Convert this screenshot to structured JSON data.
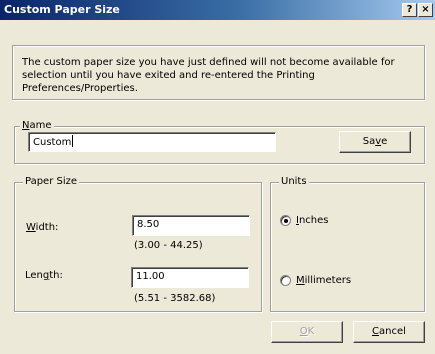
{
  "window": {
    "title": "Custom Paper Size",
    "help_button": "?",
    "close_button": "×"
  },
  "message": "The custom paper size you have just defined will not become available for selection until you have exited and re-entered the Printing Preferences/Properties.",
  "name_group": {
    "legend_prefix": "",
    "legend_accel": "N",
    "legend_rest": "ame",
    "value": "Custom",
    "save_prefix": "Sa",
    "save_accel": "v",
    "save_rest": "e"
  },
  "paper_size": {
    "legend": "Paper Size",
    "width_prefix": "",
    "width_accel": "W",
    "width_rest": "idth:",
    "width_value": "8.50",
    "width_range": "(3.00 - 44.25)",
    "length_prefix": "Len",
    "length_accel": "g",
    "length_rest": "th:",
    "length_value": "11.00",
    "length_range": "(5.51 - 3582.68)"
  },
  "units": {
    "legend": "Units",
    "inches_accel": "I",
    "inches_rest": "nches",
    "inches_selected": true,
    "mm_accel": "M",
    "mm_rest": "illimeters",
    "mm_selected": false
  },
  "footer": {
    "ok_accel": "O",
    "ok_rest": "K",
    "cancel_accel": "C",
    "cancel_rest": "ancel"
  }
}
